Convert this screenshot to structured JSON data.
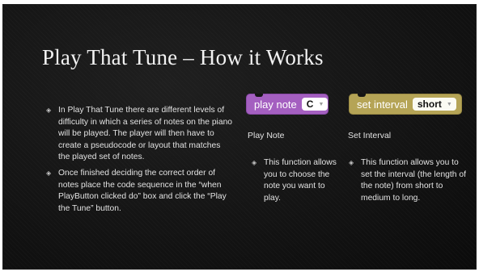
{
  "slide": {
    "title": "Play That Tune – How it Works",
    "bullets": [
      "In Play That Tune there are different levels of difficulty in which a series of notes on the piano will be played. The player will then have to create a pseudocode or layout that matches the played set of notes.",
      "Once finished deciding the correct order of notes place the code sequence in the “when PlayButton clicked do” box and click the “Play the Tune” button."
    ],
    "blocks": {
      "play_note": {
        "label": "play note",
        "value": "C",
        "caption": "Play Note",
        "description": "This function allows you to choose the note you want to play.",
        "color": "#a45fc0"
      },
      "set_interval": {
        "label": "set interval",
        "value": "short",
        "caption": "Set Interval",
        "description": "This function allows you to set the interval (the length of the note) from short to medium to long.",
        "color": "#b5a456"
      }
    },
    "icons": {
      "bullet": "diamond-bullet-icon",
      "dropdown": "triangle-down-icon"
    }
  }
}
